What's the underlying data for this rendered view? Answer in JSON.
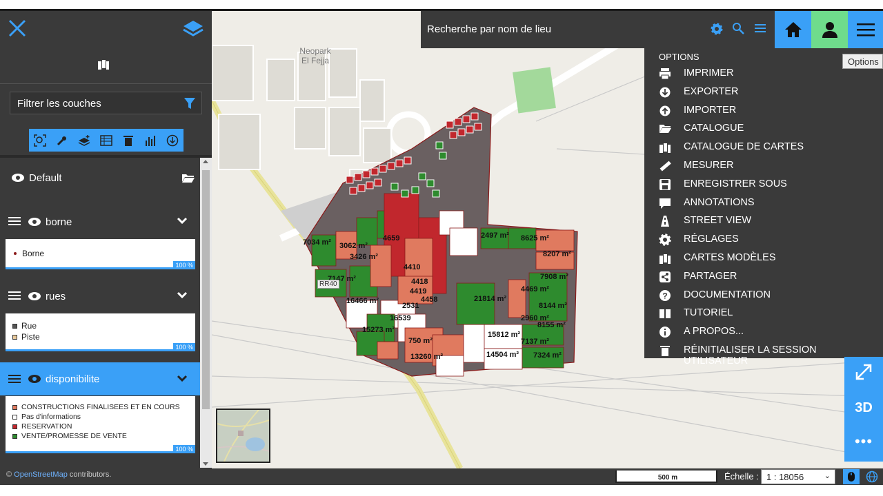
{
  "sidebar": {
    "filter_label": "Filtrer les couches",
    "layers": [
      {
        "name": "Default"
      },
      {
        "name": "borne",
        "legend": [
          {
            "label": "Borne",
            "color": "#8b1a1a",
            "shape": "dot"
          }
        ],
        "percent": "100 %"
      },
      {
        "name": "rues",
        "legend": [
          {
            "label": "Rue",
            "color": "#555555"
          },
          {
            "label": "Piste",
            "color": "#e9c99a"
          }
        ],
        "percent": "100 %"
      },
      {
        "name": "disponibilite",
        "active": true,
        "legend": [
          {
            "label": "CONSTRUCTIONS FINALISEES ET EN COURS",
            "color": "#e07a5f"
          },
          {
            "label": "Pas d'informations",
            "color": "#ffffff"
          },
          {
            "label": "RESERVATION",
            "color": "#c1272d"
          },
          {
            "label": "VENTE/PROMESSE DE VENTE",
            "color": "#2e8b2e"
          }
        ],
        "percent": "100 %"
      }
    ]
  },
  "search": {
    "placeholder": "Recherche par nom de lieu"
  },
  "tooltip": "Options",
  "options": {
    "title": "OPTIONS",
    "items": [
      {
        "label": "IMPRIMER",
        "icon": "print-icon"
      },
      {
        "label": "EXPORTER",
        "icon": "export-icon"
      },
      {
        "label": "IMPORTER",
        "icon": "import-icon"
      },
      {
        "label": "CATALOGUE",
        "icon": "folder-icon"
      },
      {
        "label": "CATALOGUE DE CARTES",
        "icon": "map-catalog-icon"
      },
      {
        "label": "MESURER",
        "icon": "ruler-icon"
      },
      {
        "label": "ENREGISTRER SOUS",
        "icon": "save-icon"
      },
      {
        "label": "ANNOTATIONS",
        "icon": "comment-icon"
      },
      {
        "label": "STREET VIEW",
        "icon": "street-view-icon"
      },
      {
        "label": "RÉGLAGES",
        "icon": "gear-icon"
      },
      {
        "label": "CARTES MODÈLES",
        "icon": "map-templates-icon"
      },
      {
        "label": "PARTAGER",
        "icon": "share-icon"
      },
      {
        "label": "DOCUMENTATION",
        "icon": "help-icon"
      },
      {
        "label": "TUTORIEL",
        "icon": "book-icon"
      },
      {
        "label": "A PROPOS...",
        "icon": "info-icon"
      },
      {
        "label": "RÉINITIALISER LA SESSION UTILISATEUR",
        "icon": "trash-icon"
      }
    ]
  },
  "right_controls": {
    "three_d": "3D",
    "more": "•••"
  },
  "bottom": {
    "attribution_prefix": "© ",
    "attribution_link": "OpenStreetMap",
    "attribution_suffix": " contributors.",
    "scale_label": "500 m",
    "echelle_label": "Échelle :",
    "echelle_value": "1 : 18056"
  },
  "map_labels": {
    "place_name_1": "Neopark",
    "place_name_2": "El Fejja",
    "road": "RR40",
    "parcels": [
      "7034 m²",
      "3062 m²",
      "3426 m²",
      "7147 m²",
      "16466 m²",
      "16539",
      "15273 m²",
      "750 m²",
      "13260 m²",
      "15812 m²",
      "14504 m²",
      "7137 m²",
      "7324 m²",
      "8155 m²",
      "8144 m²",
      "2960 m²",
      "4469 m²",
      "7908 m²",
      "8207 m²",
      "8625 m²",
      "2497 m²",
      "21814 m²",
      "4410",
      "4418",
      "4419",
      "4458",
      "2531",
      "4659"
    ]
  },
  "colors": {
    "accent": "#3aa0f7",
    "user_button": "#6fdc8c",
    "panel": "#3a3a3a"
  }
}
